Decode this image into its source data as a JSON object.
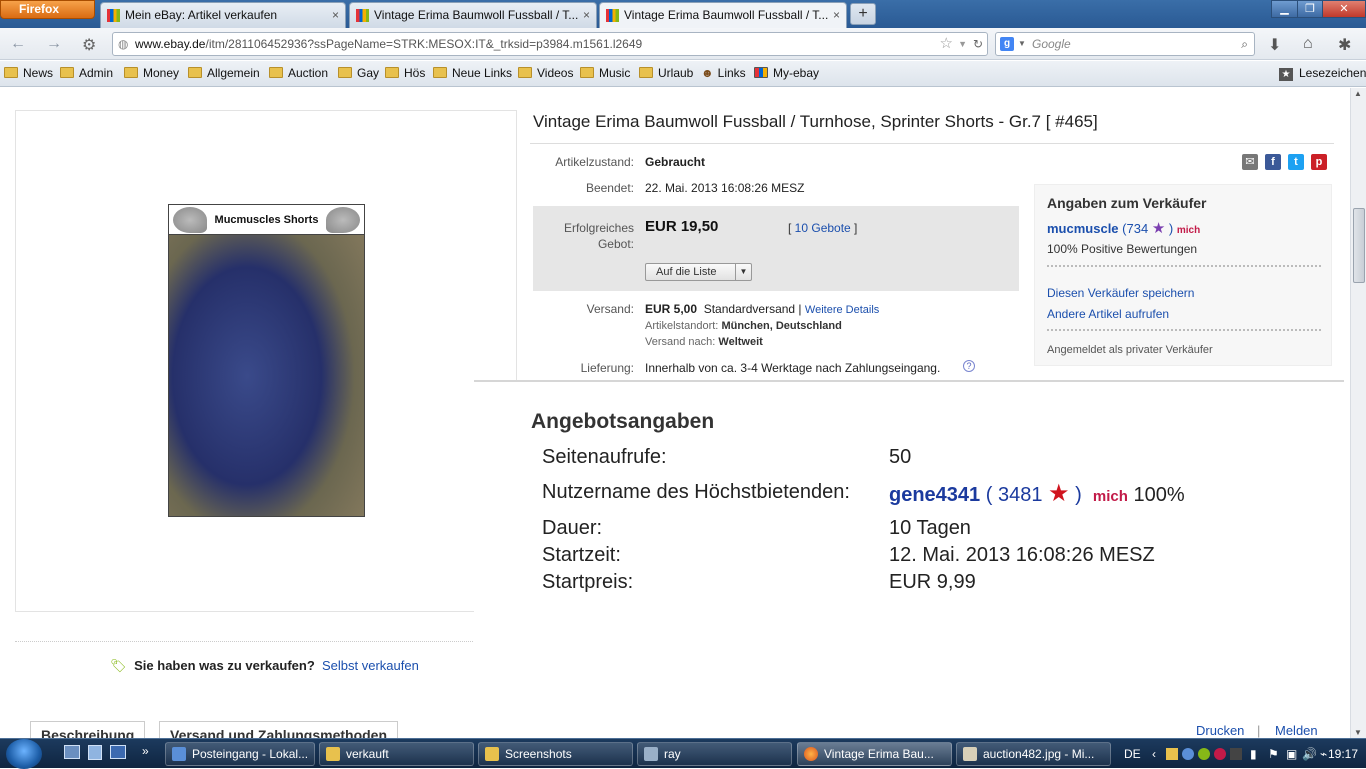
{
  "browser": {
    "app_button": "Firefox",
    "tabs": [
      {
        "label": "Mein eBay: Artikel verkaufen",
        "close": "×"
      },
      {
        "label": "Vintage Erima Baumwoll Fussball / T...",
        "close": "×"
      },
      {
        "label": "Vintage Erima Baumwoll Fussball / T...",
        "close": "×"
      }
    ],
    "new_tab": "+",
    "url_host": "www.ebay.de",
    "url_path": "/itm/281106452936?ssPageName=STRK:MESOX:IT&_trksid=p3984.m1561.l2649",
    "search_placeholder": "Google",
    "bookmarks": [
      "News",
      "Admin",
      "Money",
      "Allgemein",
      "Auction",
      "Gay",
      "Hös",
      "Neue Links",
      "Videos",
      "Music",
      "Urlaub",
      "Links",
      "My-ebay"
    ],
    "bookmarks_menu": "Lesezeichen"
  },
  "listing": {
    "image_banner": "Mucmuscles Shorts",
    "title": "Vintage Erima Baumwoll Fussball / Turnhose, Sprinter Shorts - Gr.7 [ #465]",
    "condition_label": "Artikelzustand:",
    "condition_value": "Gebraucht",
    "ended_label": "Beendet:",
    "ended_value": "22. Mai. 2013  16:08:26 MESZ",
    "bid_label_1": "Erfolgreiches",
    "bid_label_2": "Gebot:",
    "price": "EUR 19,50",
    "bids_open": "[ ",
    "bids_link": "10 Gebote",
    "bids_close": " ]",
    "watch_button": "Auf die Liste",
    "shipping_label": "Versand:",
    "shipping_price": "EUR 5,00",
    "shipping_type": "Standardversand |",
    "shipping_details": "Weitere Details",
    "location_label": "Artikelstandort:",
    "location_value": "München, Deutschland",
    "ships_to_label": "Versand nach:",
    "ships_to_value": "Weltweit",
    "delivery_label": "Lieferung:",
    "delivery_value": "Innerhalb von ca. 3-4 Werktage nach Zahlungseingang."
  },
  "seller": {
    "title": "Angaben zum Verkäufer",
    "name": "mucmuscle",
    "feedback_open": "(",
    "feedback_count": "734",
    "feedback_close": ")",
    "me_badge": "mich",
    "positive": "100% Positive Bewertungen",
    "save_link": "Diesen Verkäufer speichern",
    "other_link": "Andere Artikel aufrufen",
    "private_note": "Angemeldet als privater Verkäufer"
  },
  "offer_details": {
    "title": "Angebotsangaben",
    "views_label": "Seitenaufrufe:",
    "views_value": "50",
    "top_bidder_label": "Nutzername des Höchstbietenden:",
    "top_bidder_name": "gene4341",
    "top_bidder_open": "(",
    "top_bidder_count": "3481",
    "top_bidder_close": ")",
    "top_bidder_badge": "mich",
    "top_bidder_percent": "100%",
    "duration_label": "Dauer:",
    "duration_value": "10 Tagen",
    "start_label": "Startzeit:",
    "start_value": "12. Mai. 2013 16:08:26 MESZ",
    "start_price_label": "Startpreis:",
    "start_price_value": "EUR 9,99"
  },
  "sell_promo": {
    "question": "Sie haben was zu verkaufen?",
    "link": "Selbst verkaufen"
  },
  "bottom_tabs": [
    "Beschreibung",
    "Versand und Zahlungsmethoden"
  ],
  "footer_links": {
    "print": "Drucken",
    "separator": "|",
    "report": "Melden"
  },
  "taskbar": {
    "items": [
      "Posteingang - Lokal...",
      "verkauft",
      "Screenshots",
      "ray",
      "Vintage Erima Bau...",
      "auction482.jpg - Mi..."
    ],
    "language": "DE",
    "clock": "19:17"
  },
  "colors": {
    "ebay_link": "#1b4fad",
    "star_red": "#d0141e",
    "star_purple": "#7b3fb0"
  }
}
